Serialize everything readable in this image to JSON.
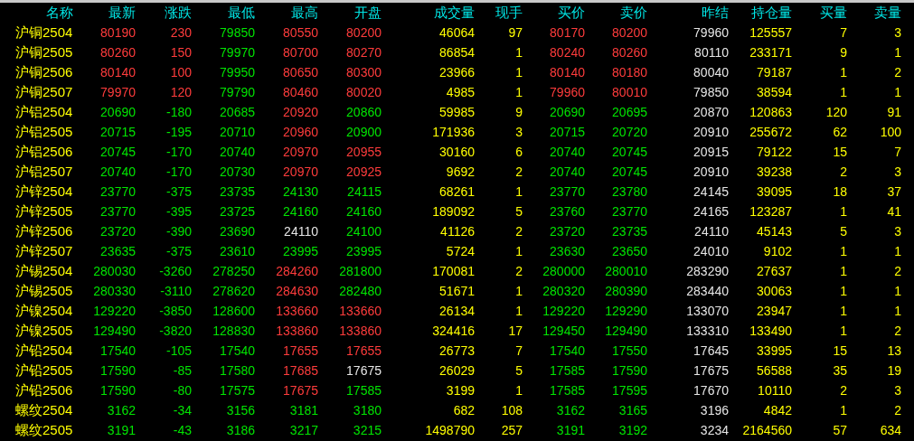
{
  "columns": [
    {
      "label": "名称",
      "kind": "name"
    },
    {
      "label": "最新",
      "kind": "price"
    },
    {
      "label": "涨跌",
      "kind": "price"
    },
    {
      "label": "最低",
      "kind": "price"
    },
    {
      "label": "最高",
      "kind": "price"
    },
    {
      "label": "开盘",
      "kind": "price"
    },
    {
      "label": "成交量",
      "kind": "volume"
    },
    {
      "label": "现手",
      "kind": "volume"
    },
    {
      "label": "买价",
      "kind": "price"
    },
    {
      "label": "卖价",
      "kind": "price"
    },
    {
      "label": "昨结",
      "kind": "reference"
    },
    {
      "label": "持仓量",
      "kind": "volume"
    },
    {
      "label": "买量",
      "kind": "volume"
    },
    {
      "label": "卖量",
      "kind": "volume"
    }
  ],
  "rows": [
    {
      "name": "沪铜2504",
      "cells": [
        {
          "text": "80190",
          "color": "#ff3c3c"
        },
        {
          "text": "230",
          "color": "#ff3c3c"
        },
        {
          "text": "79850",
          "color": "#00e600"
        },
        {
          "text": "80550",
          "color": "#ff3c3c"
        },
        {
          "text": "80200",
          "color": "#ff3c3c"
        },
        {
          "text": "46064"
        },
        {
          "text": "97"
        },
        {
          "text": "80170",
          "color": "#ff3c3c"
        },
        {
          "text": "80200",
          "color": "#ff3c3c"
        },
        {
          "text": "79960"
        },
        {
          "text": "125557"
        },
        {
          "text": "7"
        },
        {
          "text": "3"
        }
      ]
    },
    {
      "name": "沪铜2505",
      "cells": [
        {
          "text": "80260",
          "color": "#ff3c3c"
        },
        {
          "text": "150",
          "color": "#ff3c3c"
        },
        {
          "text": "79970",
          "color": "#00e600"
        },
        {
          "text": "80700",
          "color": "#ff3c3c"
        },
        {
          "text": "80270",
          "color": "#ff3c3c"
        },
        {
          "text": "86854"
        },
        {
          "text": "1"
        },
        {
          "text": "80240",
          "color": "#ff3c3c"
        },
        {
          "text": "80260",
          "color": "#ff3c3c"
        },
        {
          "text": "80110"
        },
        {
          "text": "233171"
        },
        {
          "text": "9"
        },
        {
          "text": "1"
        }
      ]
    },
    {
      "name": "沪铜2506",
      "cells": [
        {
          "text": "80140",
          "color": "#ff3c3c"
        },
        {
          "text": "100",
          "color": "#ff3c3c"
        },
        {
          "text": "79950",
          "color": "#00e600"
        },
        {
          "text": "80650",
          "color": "#ff3c3c"
        },
        {
          "text": "80300",
          "color": "#ff3c3c"
        },
        {
          "text": "23966"
        },
        {
          "text": "1"
        },
        {
          "text": "80140",
          "color": "#ff3c3c"
        },
        {
          "text": "80180",
          "color": "#ff3c3c"
        },
        {
          "text": "80040"
        },
        {
          "text": "79187"
        },
        {
          "text": "1"
        },
        {
          "text": "2"
        }
      ]
    },
    {
      "name": "沪铜2507",
      "cells": [
        {
          "text": "79970",
          "color": "#ff3c3c"
        },
        {
          "text": "120",
          "color": "#ff3c3c"
        },
        {
          "text": "79790",
          "color": "#00e600"
        },
        {
          "text": "80460",
          "color": "#ff3c3c"
        },
        {
          "text": "80020",
          "color": "#ff3c3c"
        },
        {
          "text": "4985"
        },
        {
          "text": "1"
        },
        {
          "text": "79960",
          "color": "#ff3c3c"
        },
        {
          "text": "80010",
          "color": "#ff3c3c"
        },
        {
          "text": "79850"
        },
        {
          "text": "38594"
        },
        {
          "text": "1"
        },
        {
          "text": "1"
        }
      ]
    },
    {
      "name": "沪铝2504",
      "cells": [
        {
          "text": "20690",
          "color": "#00e600"
        },
        {
          "text": "-180",
          "color": "#00e600"
        },
        {
          "text": "20685",
          "color": "#00e600"
        },
        {
          "text": "20920",
          "color": "#ff3c3c"
        },
        {
          "text": "20860",
          "color": "#00e600"
        },
        {
          "text": "59985"
        },
        {
          "text": "9"
        },
        {
          "text": "20690",
          "color": "#00e600"
        },
        {
          "text": "20695",
          "color": "#00e600"
        },
        {
          "text": "20870"
        },
        {
          "text": "120863"
        },
        {
          "text": "120"
        },
        {
          "text": "91"
        }
      ]
    },
    {
      "name": "沪铝2505",
      "cells": [
        {
          "text": "20715",
          "color": "#00e600"
        },
        {
          "text": "-195",
          "color": "#00e600"
        },
        {
          "text": "20710",
          "color": "#00e600"
        },
        {
          "text": "20960",
          "color": "#ff3c3c"
        },
        {
          "text": "20900",
          "color": "#00e600"
        },
        {
          "text": "171936"
        },
        {
          "text": "3"
        },
        {
          "text": "20715",
          "color": "#00e600"
        },
        {
          "text": "20720",
          "color": "#00e600"
        },
        {
          "text": "20910"
        },
        {
          "text": "255672"
        },
        {
          "text": "62"
        },
        {
          "text": "100"
        }
      ]
    },
    {
      "name": "沪铝2506",
      "cells": [
        {
          "text": "20745",
          "color": "#00e600"
        },
        {
          "text": "-170",
          "color": "#00e600"
        },
        {
          "text": "20740",
          "color": "#00e600"
        },
        {
          "text": "20970",
          "color": "#ff3c3c"
        },
        {
          "text": "20955",
          "color": "#ff3c3c"
        },
        {
          "text": "30160"
        },
        {
          "text": "6"
        },
        {
          "text": "20740",
          "color": "#00e600"
        },
        {
          "text": "20745",
          "color": "#00e600"
        },
        {
          "text": "20915"
        },
        {
          "text": "79122"
        },
        {
          "text": "15"
        },
        {
          "text": "7"
        }
      ]
    },
    {
      "name": "沪铝2507",
      "cells": [
        {
          "text": "20740",
          "color": "#00e600"
        },
        {
          "text": "-170",
          "color": "#00e600"
        },
        {
          "text": "20730",
          "color": "#00e600"
        },
        {
          "text": "20970",
          "color": "#ff3c3c"
        },
        {
          "text": "20925",
          "color": "#ff3c3c"
        },
        {
          "text": "9692"
        },
        {
          "text": "2"
        },
        {
          "text": "20740",
          "color": "#00e600"
        },
        {
          "text": "20745",
          "color": "#00e600"
        },
        {
          "text": "20910"
        },
        {
          "text": "39238"
        },
        {
          "text": "2"
        },
        {
          "text": "3"
        }
      ]
    },
    {
      "name": "沪锌2504",
      "cells": [
        {
          "text": "23770",
          "color": "#00e600"
        },
        {
          "text": "-375",
          "color": "#00e600"
        },
        {
          "text": "23735",
          "color": "#00e600"
        },
        {
          "text": "24130",
          "color": "#00e600"
        },
        {
          "text": "24115",
          "color": "#00e600"
        },
        {
          "text": "68261"
        },
        {
          "text": "1"
        },
        {
          "text": "23770",
          "color": "#00e600"
        },
        {
          "text": "23780",
          "color": "#00e600"
        },
        {
          "text": "24145"
        },
        {
          "text": "39095"
        },
        {
          "text": "18"
        },
        {
          "text": "37"
        }
      ]
    },
    {
      "name": "沪锌2505",
      "cells": [
        {
          "text": "23770",
          "color": "#00e600"
        },
        {
          "text": "-395",
          "color": "#00e600"
        },
        {
          "text": "23725",
          "color": "#00e600"
        },
        {
          "text": "24160",
          "color": "#00e600"
        },
        {
          "text": "24160",
          "color": "#00e600"
        },
        {
          "text": "189092"
        },
        {
          "text": "5"
        },
        {
          "text": "23760",
          "color": "#00e600"
        },
        {
          "text": "23770",
          "color": "#00e600"
        },
        {
          "text": "24165"
        },
        {
          "text": "123287"
        },
        {
          "text": "1"
        },
        {
          "text": "41"
        }
      ]
    },
    {
      "name": "沪锌2506",
      "cells": [
        {
          "text": "23720",
          "color": "#00e600"
        },
        {
          "text": "-390",
          "color": "#00e600"
        },
        {
          "text": "23690",
          "color": "#00e600"
        },
        {
          "text": "24110",
          "color": "#e6e6e6"
        },
        {
          "text": "24100",
          "color": "#00e600"
        },
        {
          "text": "41126"
        },
        {
          "text": "2"
        },
        {
          "text": "23720",
          "color": "#00e600"
        },
        {
          "text": "23735",
          "color": "#00e600"
        },
        {
          "text": "24110"
        },
        {
          "text": "45143"
        },
        {
          "text": "5"
        },
        {
          "text": "3"
        }
      ]
    },
    {
      "name": "沪锌2507",
      "cells": [
        {
          "text": "23635",
          "color": "#00e600"
        },
        {
          "text": "-375",
          "color": "#00e600"
        },
        {
          "text": "23610",
          "color": "#00e600"
        },
        {
          "text": "23995",
          "color": "#00e600"
        },
        {
          "text": "23995",
          "color": "#00e600"
        },
        {
          "text": "5724"
        },
        {
          "text": "1"
        },
        {
          "text": "23630",
          "color": "#00e600"
        },
        {
          "text": "23650",
          "color": "#00e600"
        },
        {
          "text": "24010"
        },
        {
          "text": "9102"
        },
        {
          "text": "1"
        },
        {
          "text": "1"
        }
      ]
    },
    {
      "name": "沪锡2504",
      "cells": [
        {
          "text": "280030",
          "color": "#00e600"
        },
        {
          "text": "-3260",
          "color": "#00e600"
        },
        {
          "text": "278250",
          "color": "#00e600"
        },
        {
          "text": "284260",
          "color": "#ff3c3c"
        },
        {
          "text": "281800",
          "color": "#00e600"
        },
        {
          "text": "170081"
        },
        {
          "text": "2"
        },
        {
          "text": "280000",
          "color": "#00e600"
        },
        {
          "text": "280010",
          "color": "#00e600"
        },
        {
          "text": "283290"
        },
        {
          "text": "27637"
        },
        {
          "text": "1"
        },
        {
          "text": "2"
        }
      ]
    },
    {
      "name": "沪锡2505",
      "cells": [
        {
          "text": "280330",
          "color": "#00e600"
        },
        {
          "text": "-3110",
          "color": "#00e600"
        },
        {
          "text": "278620",
          "color": "#00e600"
        },
        {
          "text": "284630",
          "color": "#ff3c3c"
        },
        {
          "text": "282480",
          "color": "#00e600"
        },
        {
          "text": "51671"
        },
        {
          "text": "1"
        },
        {
          "text": "280320",
          "color": "#00e600"
        },
        {
          "text": "280390",
          "color": "#00e600"
        },
        {
          "text": "283440"
        },
        {
          "text": "30063"
        },
        {
          "text": "1"
        },
        {
          "text": "1"
        }
      ]
    },
    {
      "name": "沪镍2504",
      "cells": [
        {
          "text": "129220",
          "color": "#00e600"
        },
        {
          "text": "-3850",
          "color": "#00e600"
        },
        {
          "text": "128600",
          "color": "#00e600"
        },
        {
          "text": "133660",
          "color": "#ff3c3c"
        },
        {
          "text": "133660",
          "color": "#ff3c3c"
        },
        {
          "text": "26134"
        },
        {
          "text": "1"
        },
        {
          "text": "129220",
          "color": "#00e600"
        },
        {
          "text": "129290",
          "color": "#00e600"
        },
        {
          "text": "133070"
        },
        {
          "text": "23947"
        },
        {
          "text": "1"
        },
        {
          "text": "1"
        }
      ]
    },
    {
      "name": "沪镍2505",
      "cells": [
        {
          "text": "129490",
          "color": "#00e600"
        },
        {
          "text": "-3820",
          "color": "#00e600"
        },
        {
          "text": "128830",
          "color": "#00e600"
        },
        {
          "text": "133860",
          "color": "#ff3c3c"
        },
        {
          "text": "133860",
          "color": "#ff3c3c"
        },
        {
          "text": "324416"
        },
        {
          "text": "17"
        },
        {
          "text": "129450",
          "color": "#00e600"
        },
        {
          "text": "129490",
          "color": "#00e600"
        },
        {
          "text": "133310"
        },
        {
          "text": "133490"
        },
        {
          "text": "1"
        },
        {
          "text": "2"
        }
      ]
    },
    {
      "name": "沪铅2504",
      "cells": [
        {
          "text": "17540",
          "color": "#00e600"
        },
        {
          "text": "-105",
          "color": "#00e600"
        },
        {
          "text": "17540",
          "color": "#00e600"
        },
        {
          "text": "17655",
          "color": "#ff3c3c"
        },
        {
          "text": "17655",
          "color": "#ff3c3c"
        },
        {
          "text": "26773"
        },
        {
          "text": "7"
        },
        {
          "text": "17540",
          "color": "#00e600"
        },
        {
          "text": "17550",
          "color": "#00e600"
        },
        {
          "text": "17645"
        },
        {
          "text": "33995"
        },
        {
          "text": "15"
        },
        {
          "text": "13"
        }
      ]
    },
    {
      "name": "沪铅2505",
      "cells": [
        {
          "text": "17590",
          "color": "#00e600"
        },
        {
          "text": "-85",
          "color": "#00e600"
        },
        {
          "text": "17580",
          "color": "#00e600"
        },
        {
          "text": "17685",
          "color": "#ff3c3c"
        },
        {
          "text": "17675",
          "color": "#e6e6e6"
        },
        {
          "text": "26029"
        },
        {
          "text": "5"
        },
        {
          "text": "17585",
          "color": "#00e600"
        },
        {
          "text": "17590",
          "color": "#00e600"
        },
        {
          "text": "17675"
        },
        {
          "text": "56588"
        },
        {
          "text": "35"
        },
        {
          "text": "19"
        }
      ]
    },
    {
      "name": "沪铅2506",
      "cells": [
        {
          "text": "17590",
          "color": "#00e600"
        },
        {
          "text": "-80",
          "color": "#00e600"
        },
        {
          "text": "17575",
          "color": "#00e600"
        },
        {
          "text": "17675",
          "color": "#ff3c3c"
        },
        {
          "text": "17585",
          "color": "#00e600"
        },
        {
          "text": "3199"
        },
        {
          "text": "1"
        },
        {
          "text": "17585",
          "color": "#00e600"
        },
        {
          "text": "17595",
          "color": "#00e600"
        },
        {
          "text": "17670"
        },
        {
          "text": "10110"
        },
        {
          "text": "2"
        },
        {
          "text": "3"
        }
      ]
    },
    {
      "name": "螺纹2504",
      "cells": [
        {
          "text": "3162",
          "color": "#00e600"
        },
        {
          "text": "-34",
          "color": "#00e600"
        },
        {
          "text": "3156",
          "color": "#00e600"
        },
        {
          "text": "3181",
          "color": "#00e600"
        },
        {
          "text": "3180",
          "color": "#00e600"
        },
        {
          "text": "682"
        },
        {
          "text": "108"
        },
        {
          "text": "3162",
          "color": "#00e600"
        },
        {
          "text": "3165",
          "color": "#00e600"
        },
        {
          "text": "3196"
        },
        {
          "text": "4842"
        },
        {
          "text": "1"
        },
        {
          "text": "2"
        }
      ]
    },
    {
      "name": "螺纹2505",
      "cells": [
        {
          "text": "3191",
          "color": "#00e600"
        },
        {
          "text": "-43",
          "color": "#00e600"
        },
        {
          "text": "3186",
          "color": "#00e600"
        },
        {
          "text": "3217",
          "color": "#00e600"
        },
        {
          "text": "3215",
          "color": "#00e600"
        },
        {
          "text": "1498790"
        },
        {
          "text": "257"
        },
        {
          "text": "3191",
          "color": "#00e600"
        },
        {
          "text": "3192",
          "color": "#00e600"
        },
        {
          "text": "3234"
        },
        {
          "text": "2164560"
        },
        {
          "text": "57"
        },
        {
          "text": "634"
        }
      ]
    }
  ]
}
